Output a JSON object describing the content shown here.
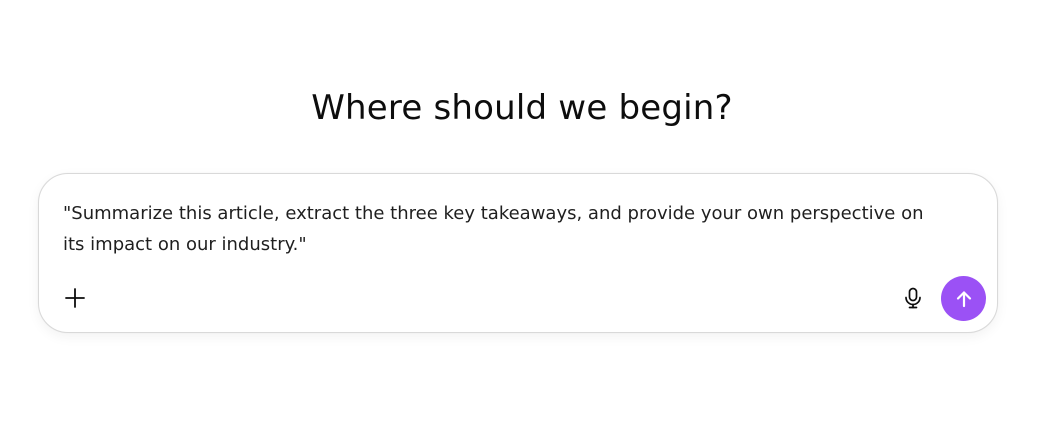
{
  "heading": "Where should we begin?",
  "composer": {
    "prompt_text": "\"Summarize this article, extract the three key takeaways, and provide your own perspective on its impact on our industry.\"",
    "icons": {
      "add": "plus-icon",
      "mic": "microphone-icon",
      "send": "arrow-up-icon"
    }
  },
  "colors": {
    "send_button": "#9b51f5",
    "border": "#d9d9d9",
    "text": "#0d0d0d"
  }
}
